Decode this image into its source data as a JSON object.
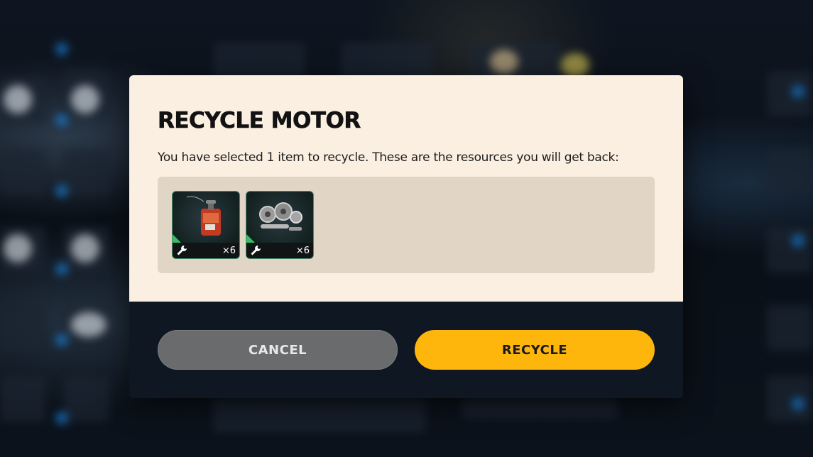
{
  "dialog": {
    "title": "RECYCLE MOTOR",
    "description": "You have selected 1 item to recycle. These are the resources you will get back:",
    "resources": [
      {
        "icon": "fuel-can-icon",
        "quantity": "×6",
        "tool_icon": "wrench-icon"
      },
      {
        "icon": "gears-parts-icon",
        "quantity": "×6",
        "tool_icon": "wrench-icon"
      }
    ],
    "cancel_label": "CANCEL",
    "recycle_label": "RECYCLE"
  },
  "colors": {
    "dialog_top": "#fbefe1",
    "dialog_bottom": "#0f1723",
    "panel": "#e1d6c5",
    "recycle_button": "#ffb60c",
    "cancel_button": "#6a6b6d",
    "rarity_green": "#3cc66a"
  }
}
